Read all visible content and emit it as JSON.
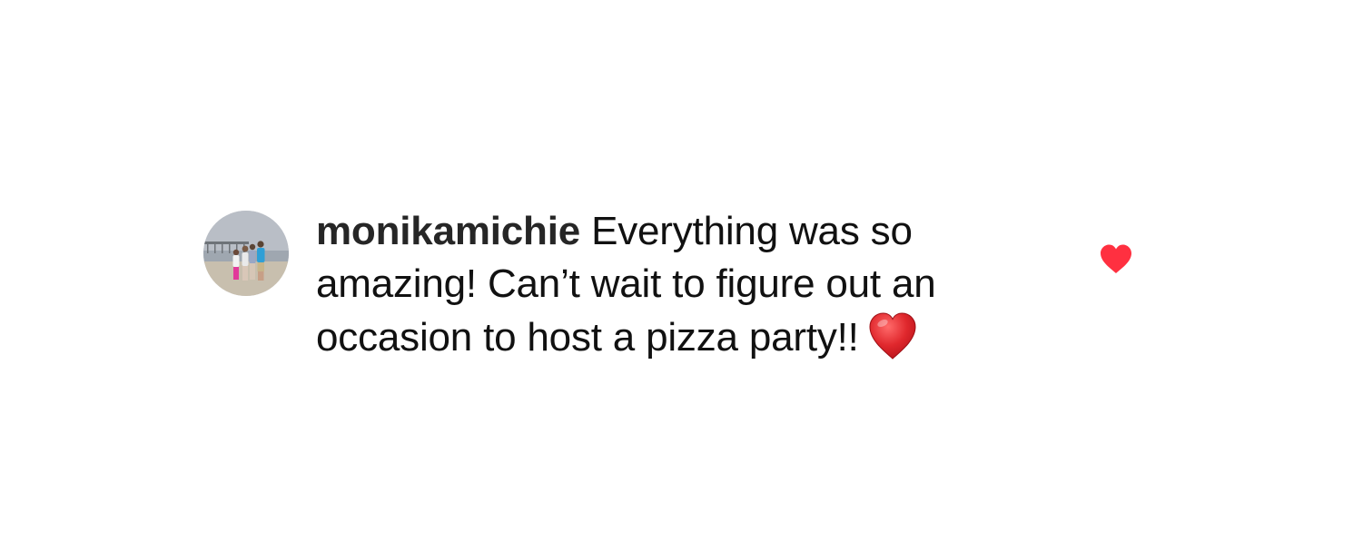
{
  "comment": {
    "username": "monikamichie",
    "text": "Everything was so amazing! Can’t wait to figure out an occasion to host a pizza party!!",
    "emoji": "red-heart-emoji",
    "liked": true
  },
  "icons": {
    "like": "heart-filled-icon",
    "avatar": "user-avatar-photo"
  },
  "colors": {
    "username": "#262626",
    "text": "#111111",
    "like_heart": "#ff3040",
    "emoji_heart": "#e0282d"
  }
}
